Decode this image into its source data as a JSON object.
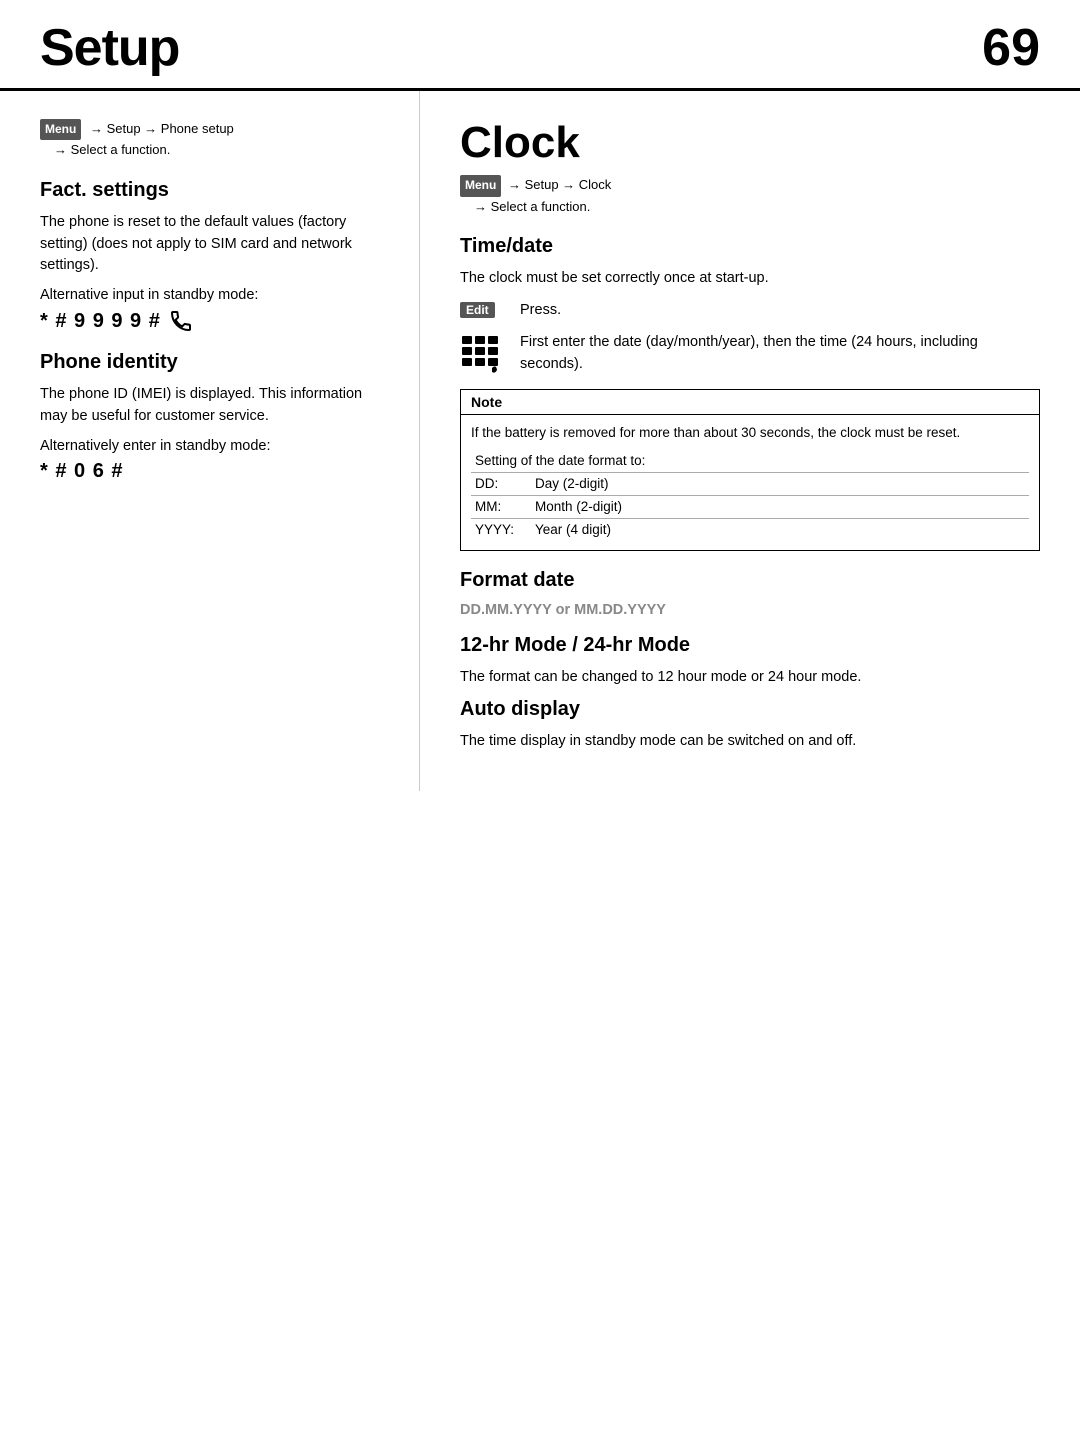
{
  "header": {
    "title": "Setup",
    "page_number": "69"
  },
  "left": {
    "breadcrumb": {
      "menu": "Menu",
      "path": "→ Setup → Phone setup",
      "sub": "→ Select a function."
    },
    "fact_settings": {
      "heading": "Fact. settings",
      "text": "The phone is reset to the default values (factory setting) (does not apply to SIM card and network settings).",
      "alt_label": "Alternative input in standby mode:",
      "code": "* # 9 9 9 9 #"
    },
    "phone_identity": {
      "heading": "Phone identity",
      "text": "The phone ID (IMEI) is displayed. This information may be useful for customer service.",
      "alt_label": "Alternatively enter in standby mode:",
      "code": "* # 0 6 #"
    }
  },
  "right": {
    "clock_heading": "Clock",
    "breadcrumb": {
      "menu": "Menu",
      "path": "→ Setup → Clock",
      "sub": "→ Select a function."
    },
    "time_date": {
      "heading": "Time/date",
      "text": "The clock must be set correctly once at start-up.",
      "edit_label": "Edit",
      "edit_instruction": "Press.",
      "numpad_instruction": "First enter the date (day/month/year), then the time (24 hours, including seconds)."
    },
    "note": {
      "header": "Note",
      "line1": "If the battery is removed for more than about 30 seconds, the clock must be reset.",
      "format_label": "Setting of the date format to:",
      "rows": [
        {
          "code": "DD:",
          "desc": "Day (2-digit)"
        },
        {
          "code": "MM:",
          "desc": "Month (2-digit)"
        },
        {
          "code": "YYYY:",
          "desc": "Year (4 digit)"
        }
      ]
    },
    "format_date": {
      "heading": "Format date",
      "codes": "DD.MM.YYYY or MM.DD.YYYY"
    },
    "hr_mode": {
      "heading": "12-hr Mode / 24-hr Mode",
      "text": "The format can be changed to 12 hour mode or 24 hour mode."
    },
    "auto_display": {
      "heading": "Auto display",
      "text": "The time display in standby mode can be switched on and off."
    }
  }
}
